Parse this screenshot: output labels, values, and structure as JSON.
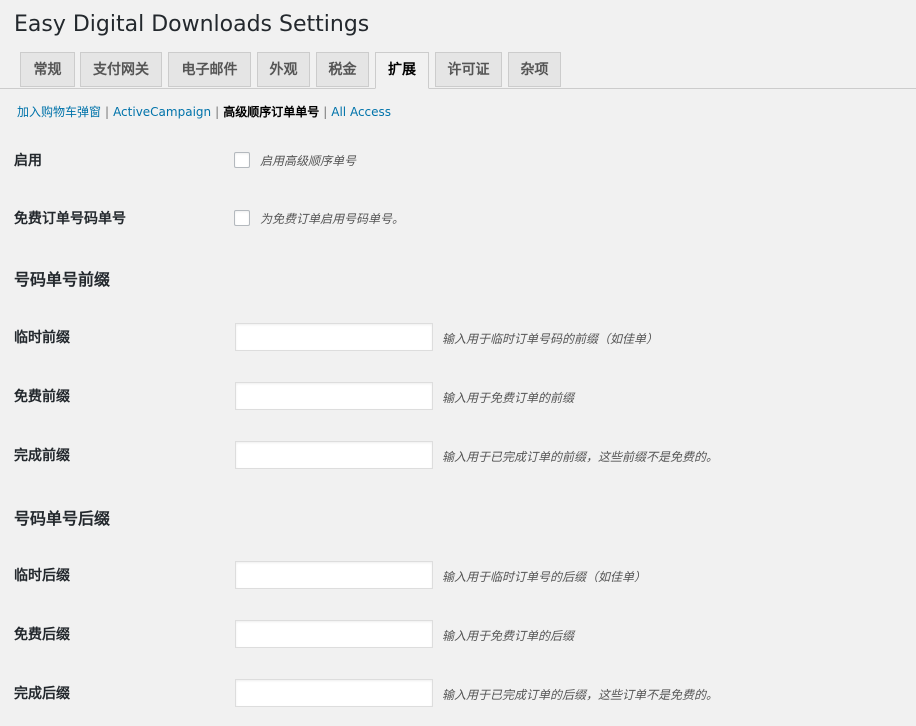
{
  "page": {
    "title": "Easy Digital Downloads Settings"
  },
  "tabs": [
    {
      "label": "常规"
    },
    {
      "label": "支付网关"
    },
    {
      "label": "电子邮件"
    },
    {
      "label": "外观"
    },
    {
      "label": "税金"
    },
    {
      "label": "扩展",
      "active": true
    },
    {
      "label": "许可证"
    },
    {
      "label": "杂项"
    }
  ],
  "subnav": {
    "items": [
      {
        "label": "加入购物车弹窗"
      },
      {
        "label": "ActiveCampaign"
      },
      {
        "label": "高级顺序订单单号",
        "current": true
      },
      {
        "label": "All Access"
      }
    ],
    "separator": "|"
  },
  "settings": {
    "enable": {
      "label": "启用",
      "description": "启用高级顺序单号",
      "checked": false
    },
    "free_numbering": {
      "label": "免费订单号码单号",
      "description": "为免费订单启用号码单号。",
      "checked": false
    },
    "prefix_section": {
      "heading": "号码单号前缀",
      "temp": {
        "label": "临时前缀",
        "value": "",
        "description": "输入用于临时订单号码的前缀（如佳单）"
      },
      "free": {
        "label": "免费前缀",
        "value": "",
        "description": "输入用于免费订单的前缀"
      },
      "complete": {
        "label": "完成前缀",
        "value": "",
        "description": "输入用于已完成订单的前缀，这些前缀不是免费的。"
      }
    },
    "suffix_section": {
      "heading": "号码单号后缀",
      "temp": {
        "label": "临时后缀",
        "value": "",
        "description": "输入用于临时订单号的后缀（如佳单）"
      },
      "free": {
        "label": "免费后缀",
        "value": "",
        "description": "输入用于免费订单的后缀"
      },
      "complete": {
        "label": "完成后缀",
        "value": "",
        "description": "输入用于已完成订单的后缀，这些订单不是免费的。"
      }
    }
  },
  "colors": {
    "background": "#f1f1f1",
    "link": "#0073aa",
    "tab_inactive": "#e5e5e5",
    "border": "#cccccc"
  }
}
